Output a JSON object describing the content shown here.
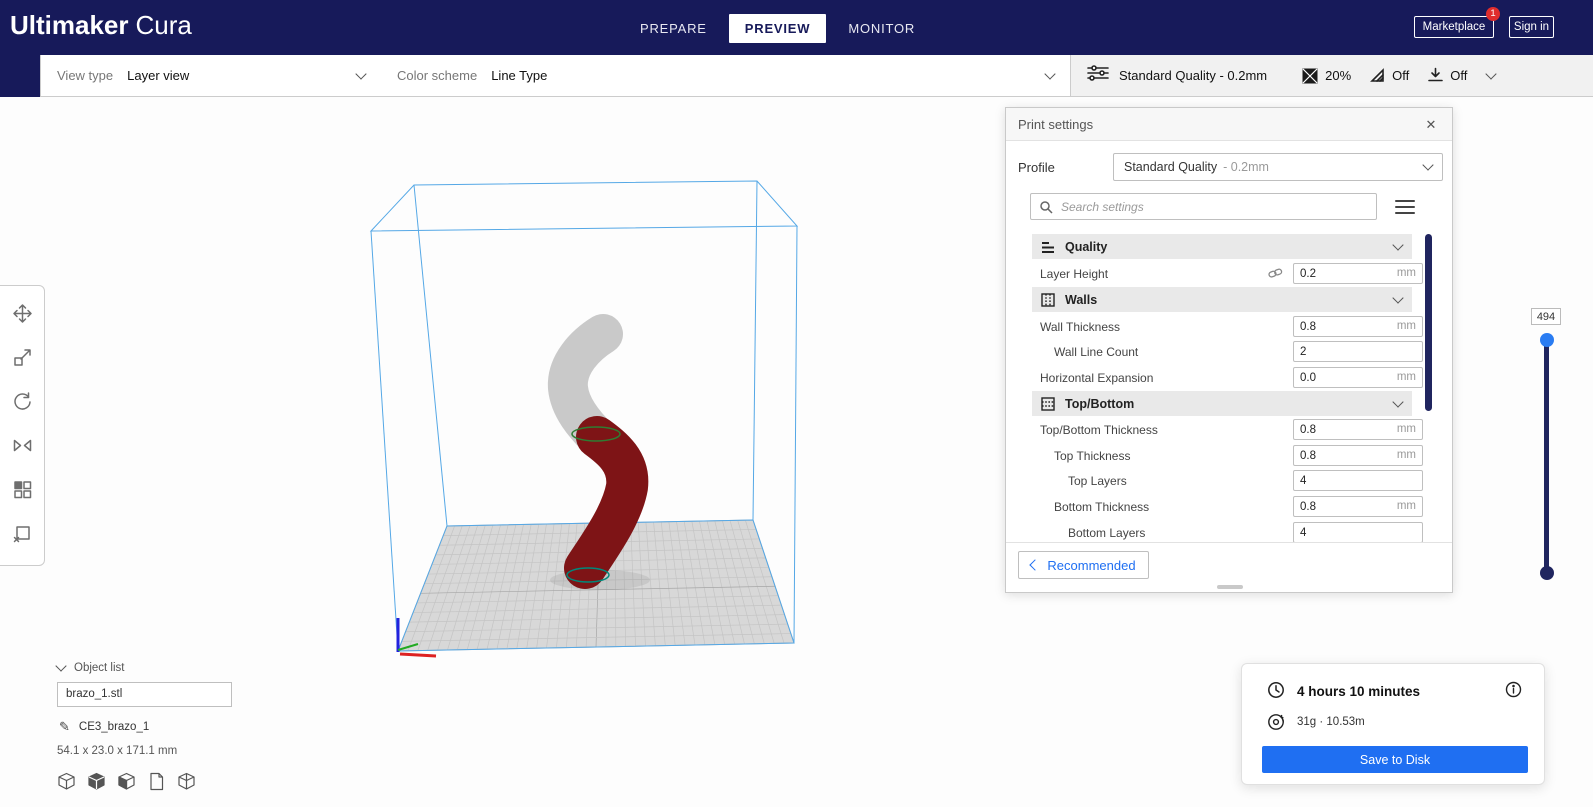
{
  "header": {
    "logo_bold": "Ultimaker",
    "logo_light": "Cura",
    "tabs": [
      {
        "label": "PREPARE",
        "active": false
      },
      {
        "label": "PREVIEW",
        "active": true
      },
      {
        "label": "MONITOR",
        "active": false
      }
    ],
    "marketplace_label": "Marketplace",
    "marketplace_badge": "1",
    "signin_label": "Sign in"
  },
  "stage_menu": {
    "view_type_label": "View type",
    "view_type_value": "Layer view",
    "color_scheme_label": "Color scheme",
    "color_scheme_value": "Line Type"
  },
  "settings_summary": {
    "profile": "Standard Quality - 0.2mm",
    "infill": "20%",
    "support": "Off",
    "adhesion": "Off"
  },
  "print_settings": {
    "title": "Print settings",
    "profile_label": "Profile",
    "profile_value": "Standard Quality",
    "profile_suffix": "- 0.2mm",
    "search_placeholder": "Search settings",
    "recommended_label": "Recommended",
    "rows": [
      {
        "type": "category",
        "label": "Quality"
      },
      {
        "type": "setting",
        "label": "Layer Height",
        "value": "0.2",
        "unit": "mm",
        "indent": 0,
        "linked": true
      },
      {
        "type": "category",
        "label": "Walls"
      },
      {
        "type": "setting",
        "label": "Wall Thickness",
        "value": "0.8",
        "unit": "mm",
        "indent": 0
      },
      {
        "type": "setting",
        "label": "Wall Line Count",
        "value": "2",
        "unit": "",
        "indent": 1
      },
      {
        "type": "setting",
        "label": "Horizontal Expansion",
        "value": "0.0",
        "unit": "mm",
        "indent": 0
      },
      {
        "type": "category",
        "label": "Top/Bottom"
      },
      {
        "type": "setting",
        "label": "Top/Bottom Thickness",
        "value": "0.8",
        "unit": "mm",
        "indent": 0
      },
      {
        "type": "setting",
        "label": "Top Thickness",
        "value": "0.8",
        "unit": "mm",
        "indent": 1
      },
      {
        "type": "setting",
        "label": "Top Layers",
        "value": "4",
        "unit": "",
        "indent": 2
      },
      {
        "type": "setting",
        "label": "Bottom Thickness",
        "value": "0.8",
        "unit": "mm",
        "indent": 1
      },
      {
        "type": "setting",
        "label": "Bottom Layers",
        "value": "4",
        "unit": "",
        "indent": 2
      }
    ]
  },
  "layer_slider": {
    "current_layer": "494"
  },
  "object_list": {
    "toggle_label": "Object list",
    "items": [
      {
        "name": "brazo_1.stl"
      }
    ],
    "printer_name": "CE3_brazo_1",
    "dimensions": "54.1 x 23.0 x 171.1 mm"
  },
  "job_panel": {
    "print_time": "4 hours 10 minutes",
    "material_usage": "31g · 10.53m",
    "save_button_label": "Save to Disk"
  },
  "icons": {
    "close": "✕",
    "pencil": "✎"
  },
  "colors": {
    "header_bg": "#171a5a",
    "accent_blue": "#1f6ff2",
    "badge_red": "#e02d2d",
    "scroll_navy": "#20255f",
    "model_red": "#7e1416",
    "model_gray": "#c9c9c9",
    "wireframe_blue": "#55a8e6",
    "seam_green": "#2e7d32",
    "seam_teal": "#00897b"
  }
}
